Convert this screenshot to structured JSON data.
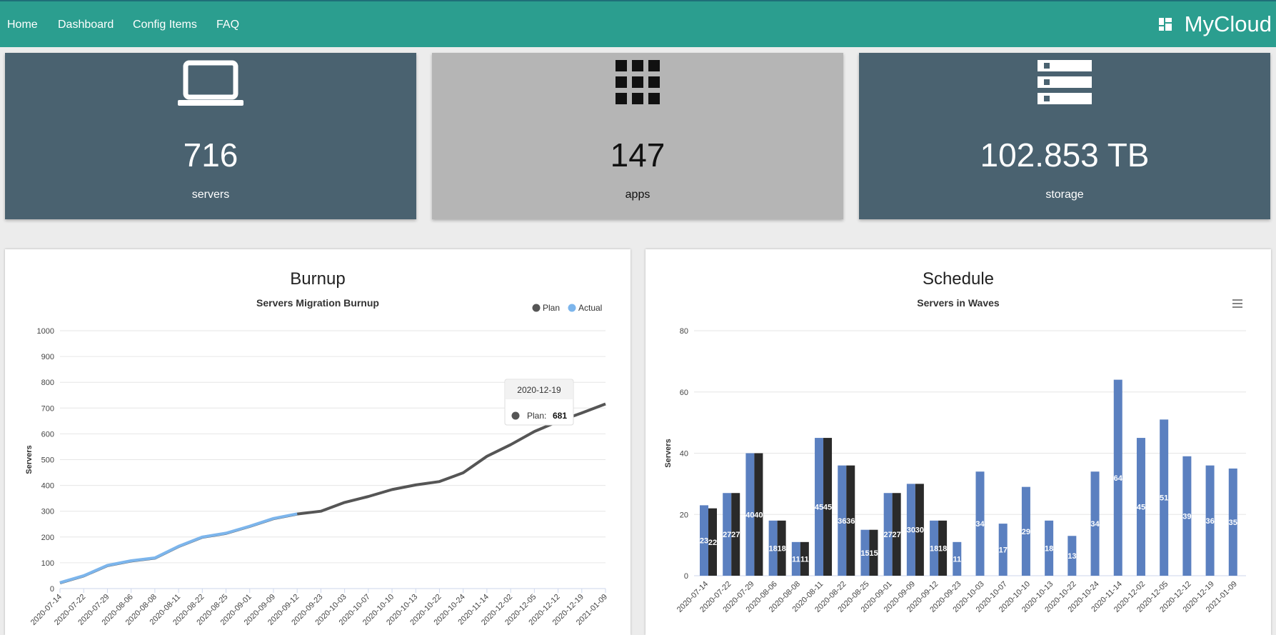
{
  "nav": {
    "links": [
      "Home",
      "Dashboard",
      "Config Items",
      "FAQ"
    ],
    "brand": "MyCloud",
    "brand_icon": "dashboard-grid-icon"
  },
  "cards": [
    {
      "icon": "laptop-icon",
      "value": "716",
      "label": "servers"
    },
    {
      "icon": "apps-grid-icon",
      "value": "147",
      "label": "apps"
    },
    {
      "icon": "server-rack-icon",
      "value": "102.853 TB",
      "label": "storage"
    }
  ],
  "colors": {
    "navbar": "#2b9e8f",
    "card_dark": "#4a6270",
    "card_light": "#b5b5b5",
    "plan": "#555555",
    "actual": "#7cb5ec",
    "bar_blue": "#5b80c0",
    "bar_black": "#2a2a2a"
  },
  "burnup": {
    "panel_title": "Burnup",
    "tooltip": {
      "date": "2020-12-19",
      "series": "Plan:",
      "value": "681"
    }
  },
  "schedule": {
    "panel_title": "Schedule",
    "menu_icon": "hamburger-menu-icon"
  },
  "chart_data": [
    {
      "type": "line",
      "title": "Servers Migration Burnup",
      "ylabel": "Servers",
      "xlabel": "",
      "ylim": [
        0,
        1000
      ],
      "yticks": [
        0,
        100,
        200,
        300,
        400,
        500,
        600,
        700,
        800,
        900,
        1000
      ],
      "legend": "top-right",
      "grid": true,
      "x": [
        "2020-07-14",
        "2020-07-22",
        "2020-07-29",
        "2020-08-06",
        "2020-08-08",
        "2020-08-11",
        "2020-08-22",
        "2020-08-25",
        "2020-09-01",
        "2020-09-09",
        "2020-09-12",
        "2020-09-23",
        "2020-10-03",
        "2020-10-07",
        "2020-10-10",
        "2020-10-13",
        "2020-10-22",
        "2020-10-24",
        "2020-11-14",
        "2020-12-02",
        "2020-12-05",
        "2020-12-12",
        "2020-12-19",
        "2021-01-09"
      ],
      "series": [
        {
          "name": "Plan",
          "values": [
            22,
            49,
            89,
            107,
            118,
            163,
            199,
            214,
            241,
            271,
            289,
            300,
            334,
            357,
            384,
            402,
            415,
            449,
            513,
            558,
            609,
            648,
            681,
            716
          ]
        },
        {
          "name": "Actual",
          "values": [
            23,
            50,
            90,
            108,
            119,
            164,
            200,
            215,
            242,
            272,
            290,
            null,
            null,
            null,
            null,
            null,
            null,
            null,
            null,
            null,
            null,
            null,
            null,
            null
          ]
        }
      ]
    },
    {
      "type": "bar",
      "title": "Servers in Waves",
      "ylabel": "Servers",
      "xlabel": "",
      "ylim": [
        0,
        80
      ],
      "yticks": [
        0,
        20,
        40,
        60,
        80
      ],
      "grid": true,
      "categories": [
        "2020-07-14",
        "2020-07-22",
        "2020-07-29",
        "2020-08-06",
        "2020-08-08",
        "2020-08-11",
        "2020-08-22",
        "2020-08-25",
        "2020-09-01",
        "2020-09-09",
        "2020-09-12",
        "2020-09-23",
        "2020-10-03",
        "2020-10-07",
        "2020-10-10",
        "2020-10-13",
        "2020-10-22",
        "2020-10-24",
        "2020-11-14",
        "2020-12-02",
        "2020-12-05",
        "2020-12-12",
        "2020-12-19",
        "2021-01-09"
      ],
      "series": [
        {
          "values": [
            23,
            27,
            40,
            18,
            11,
            45,
            36,
            15,
            27,
            30,
            18,
            11,
            34,
            17,
            29,
            18,
            13,
            34,
            64,
            45,
            51,
            39,
            36,
            35
          ]
        },
        {
          "values": [
            22,
            27,
            40,
            18,
            11,
            45,
            36,
            15,
            27,
            30,
            18,
            null,
            null,
            null,
            null,
            null,
            null,
            null,
            null,
            null,
            null,
            null,
            null,
            null
          ]
        }
      ]
    }
  ]
}
